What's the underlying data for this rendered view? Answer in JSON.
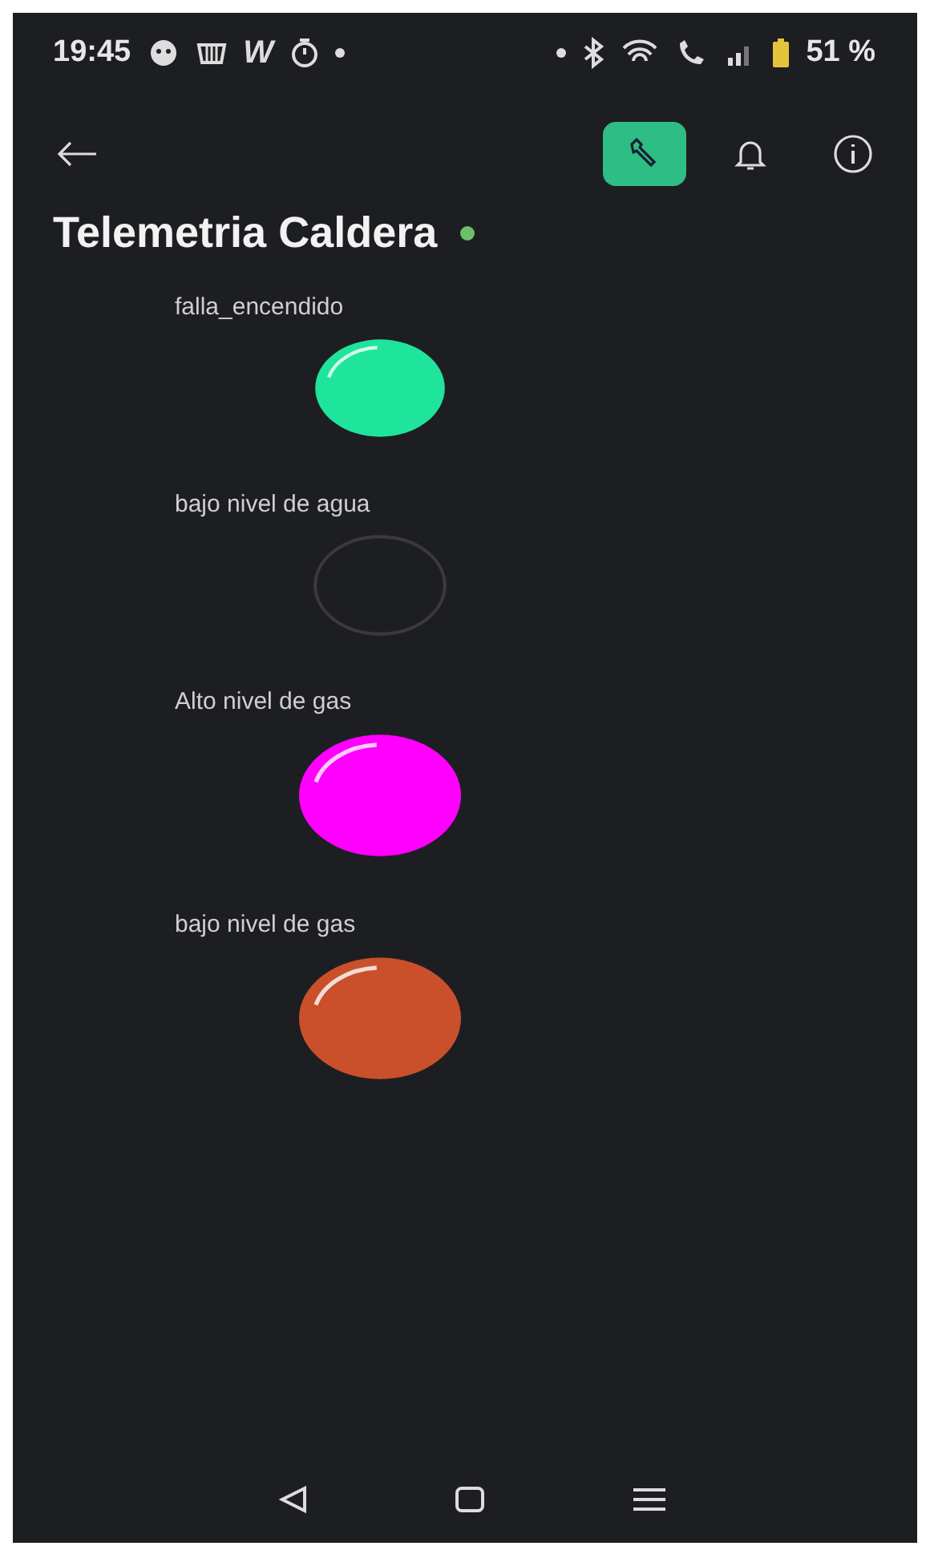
{
  "status_bar": {
    "time": "19:45",
    "app_letter": "W",
    "battery": "51 %"
  },
  "toolbar": [
    {
      "kind": "wrench",
      "selected": true
    },
    {
      "kind": "bell",
      "selected": false
    },
    {
      "kind": "info",
      "selected": false
    }
  ],
  "title": "Telemetria Caldera",
  "online": true,
  "leds": [
    {
      "label": "falla_encendido",
      "on": true,
      "color": "#1ee59b"
    },
    {
      "label": "bajo nivel de agua",
      "on": false,
      "color": "#3a3a3a"
    },
    {
      "label": "Alto nivel de gas",
      "on": true,
      "color": "#ff00ff"
    },
    {
      "label": "bajo nivel de gas",
      "on": true,
      "color": "#c9502b"
    }
  ]
}
